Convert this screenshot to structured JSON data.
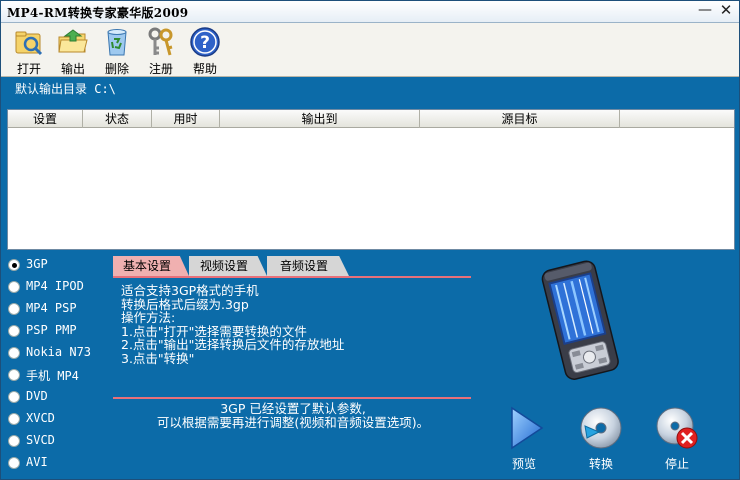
{
  "window": {
    "title": "MP4-RM转换专家豪华版2009",
    "minimize": "—",
    "close": "✕"
  },
  "toolbar": {
    "items": [
      {
        "label": "打开",
        "icon": "open-folder-icon"
      },
      {
        "label": "输出",
        "icon": "output-folder-icon"
      },
      {
        "label": "删除",
        "icon": "recycle-bin-icon"
      },
      {
        "label": "注册",
        "icon": "keys-icon"
      },
      {
        "label": "帮助",
        "icon": "help-icon"
      }
    ]
  },
  "output_dir": {
    "text": "默认输出目录 C:\\"
  },
  "file_list": {
    "columns": [
      "设置",
      "状态",
      "用时",
      "输出到",
      "源目标"
    ],
    "rows": []
  },
  "formats": {
    "items": [
      "3GP",
      "MP4 IPOD",
      "MP4 PSP",
      "PSP PMP",
      "Nokia N73",
      "手机 MP4",
      "DVD",
      "XVCD",
      "SVCD",
      "AVI"
    ],
    "selected": "3GP"
  },
  "settings_tabs": {
    "items": [
      "基本设置",
      "视频设置",
      "音频设置"
    ],
    "active": "基本设置"
  },
  "description": {
    "lines": [
      "适合支持3GP格式的手机",
      "转换后格式后缀为.3gp",
      "操作方法:",
      "1.点击\"打开\"选择需要转换的文件",
      "2.点击\"输出\"选择转换后文件的存放地址",
      "3.点击\"转换\""
    ]
  },
  "notice": {
    "line1": "3GP 已经设置了默认参数,",
    "line2": "可以根据需要再进行调整(视频和音频设置选项)。"
  },
  "actions": {
    "preview": "预览",
    "convert": "转换",
    "stop": "停止"
  },
  "colors": {
    "window_bg": "#0c6ba8",
    "accent_rule": "#e8707a",
    "active_tab": "#f0b0b0"
  }
}
